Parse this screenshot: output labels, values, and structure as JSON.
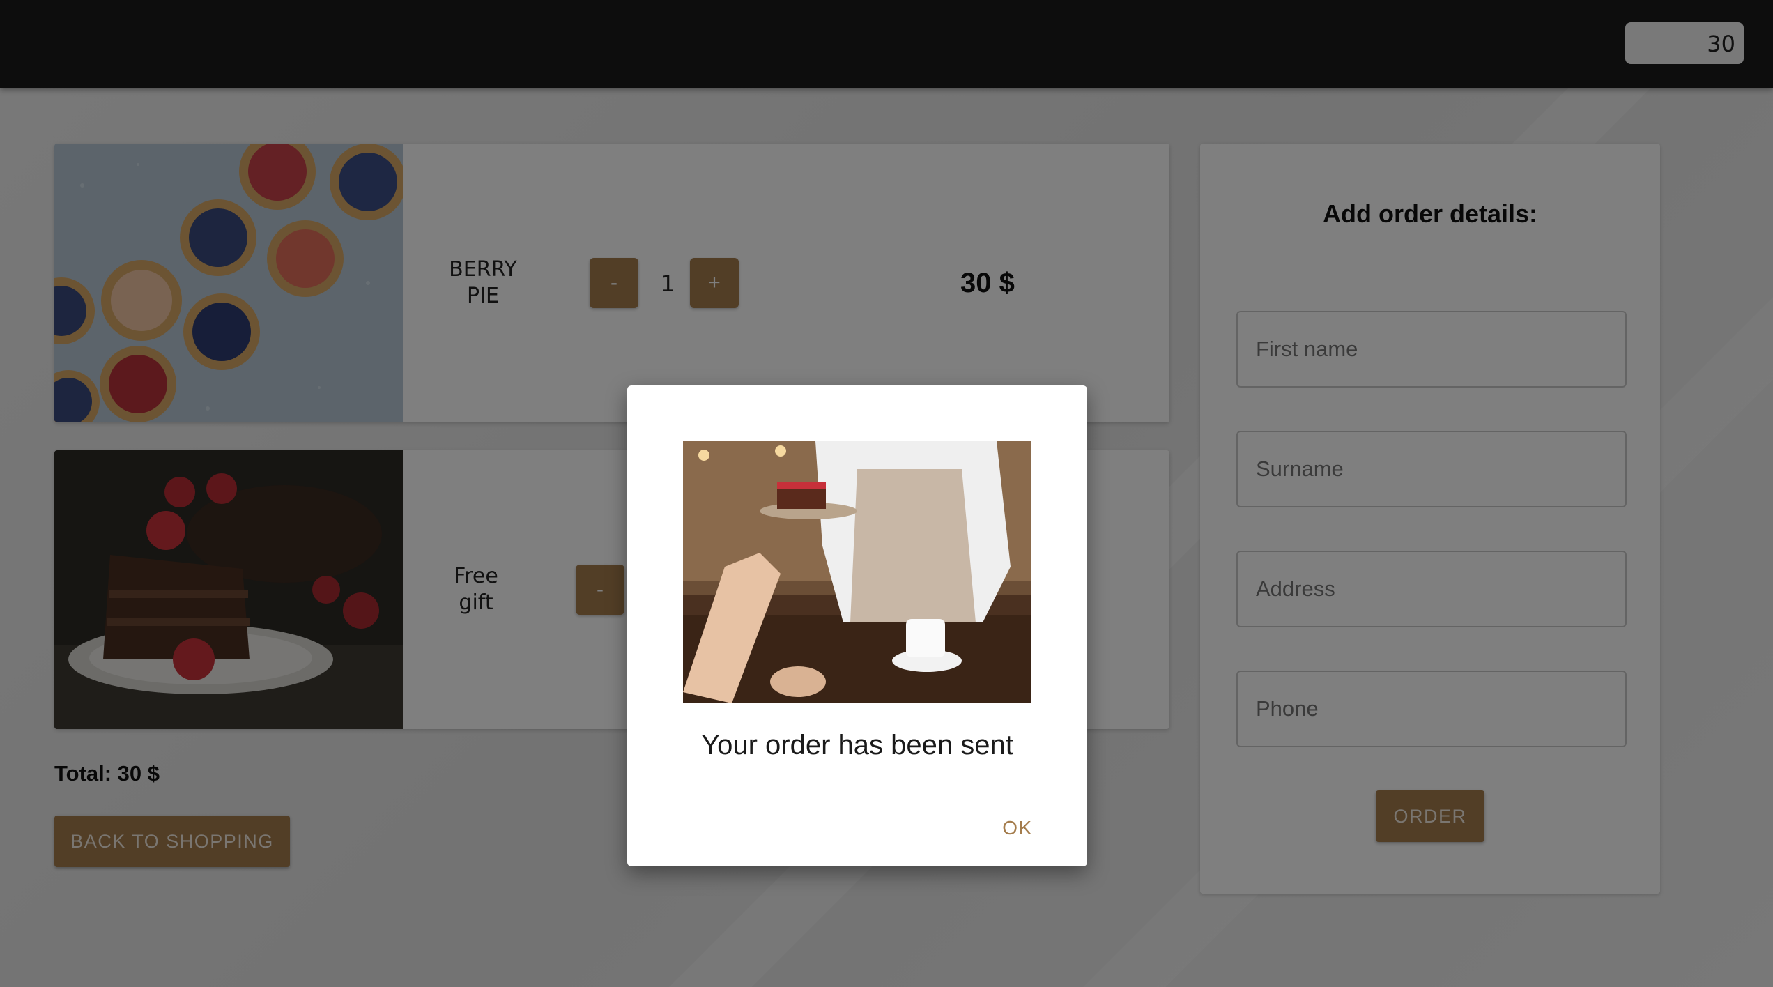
{
  "header": {
    "cart_total": "30"
  },
  "cart": {
    "items": [
      {
        "name": "BERRY\nPIE",
        "quantity": "1",
        "price": "30 $",
        "minus": "-",
        "plus": "+"
      },
      {
        "name": "Free\ngift",
        "minus": "-"
      }
    ],
    "total": "Total: 30 $",
    "back_label": "BACK TO SHOPPING"
  },
  "form": {
    "title": "Add order details:",
    "fields": {
      "first_name": "First name",
      "surname": "Surname",
      "address": "Address",
      "phone": "Phone"
    },
    "order_label": "ORDER"
  },
  "dialog": {
    "message": "Your order has been sent",
    "ok_label": "OK"
  },
  "colors": {
    "accent": "#a47c4c",
    "appbar": "#1b1b1b"
  }
}
